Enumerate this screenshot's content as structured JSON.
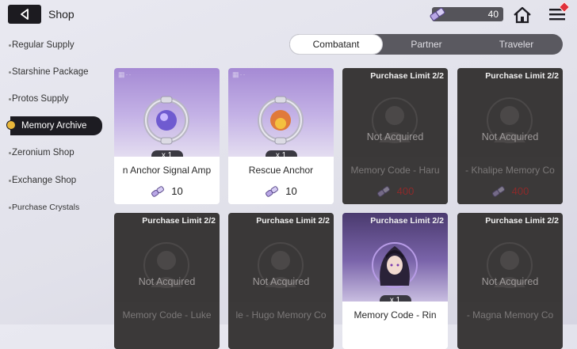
{
  "header": {
    "title": "Shop",
    "currency_amount": "40",
    "icons": {
      "back": "back-arrow-icon",
      "currency": "crystal-currency-icon",
      "home": "home-icon",
      "menu": "menu-icon"
    }
  },
  "sidebar": {
    "items": [
      {
        "label": "Regular Supply"
      },
      {
        "label": "Starshine Package"
      },
      {
        "label": "Protos Supply"
      },
      {
        "label": "Memory Archive",
        "active": true
      },
      {
        "label": "Zeronium Shop"
      },
      {
        "label": "Exchange Shop"
      },
      {
        "label": "Purchase Crystals"
      }
    ]
  },
  "tabs": [
    {
      "label": "Combatant",
      "active": true
    },
    {
      "label": "Partner"
    },
    {
      "label": "Traveler"
    }
  ],
  "cards": [
    {
      "name": "n Anchor   Signal Amp",
      "qty": "x 1",
      "price": "10",
      "limit": "",
      "status": "",
      "state": "available"
    },
    {
      "name": "Rescue Anchor",
      "qty": "x 1",
      "price": "10",
      "limit": "",
      "status": "",
      "state": "available"
    },
    {
      "name": "Memory Code - Haru",
      "qty": "",
      "price": "400",
      "limit": "Purchase Limit 2/2",
      "status": "Not Acquired",
      "state": "locked"
    },
    {
      "name": "- Khalipe   Memory Co",
      "qty": "",
      "price": "400",
      "limit": "Purchase Limit 2/2",
      "status": "Not Acquired",
      "state": "locked"
    },
    {
      "name": "Memory Code - Luke",
      "qty": "",
      "price": "",
      "limit": "Purchase Limit 2/2",
      "status": "Not Acquired",
      "state": "locked"
    },
    {
      "name": "le - Hugo   Memory Co",
      "qty": "",
      "price": "",
      "limit": "Purchase Limit 2/2",
      "status": "Not Acquired",
      "state": "locked"
    },
    {
      "name": "Memory Code - Rin",
      "qty": "x 1",
      "price": "",
      "limit": "Purchase Limit 2/2",
      "status": "",
      "state": "available"
    },
    {
      "name": "- Magna   Memory Co",
      "qty": "",
      "price": "",
      "limit": "Purchase Limit 2/2",
      "status": "Not Acquired",
      "state": "locked"
    }
  ]
}
